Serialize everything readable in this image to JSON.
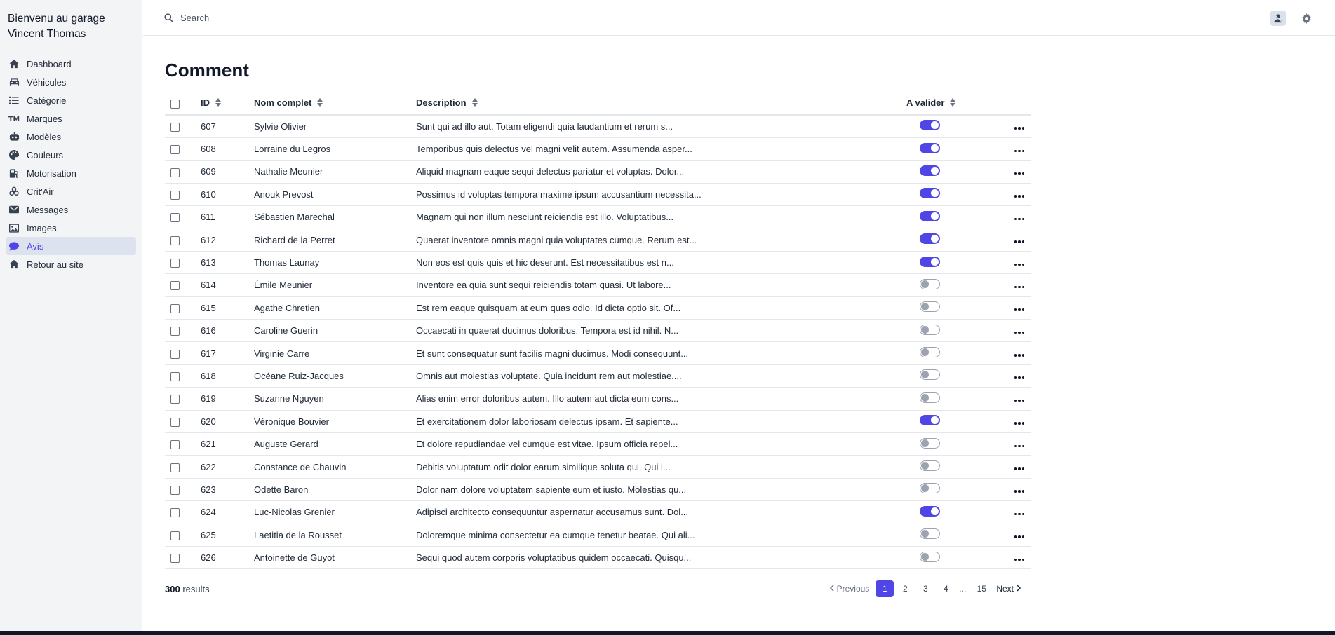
{
  "sidebar": {
    "brand_line1": "Bienvenu au garage",
    "brand_line2": "Vincent Thomas",
    "items": [
      {
        "label": "Dashboard",
        "icon": "home-icon"
      },
      {
        "label": "Véhicules",
        "icon": "car-icon"
      },
      {
        "label": "Catégorie",
        "icon": "list-icon"
      },
      {
        "label": "Marques",
        "icon": "trademark-icon"
      },
      {
        "label": "Modèles",
        "icon": "robot-icon"
      },
      {
        "label": "Couleurs",
        "icon": "palette-icon"
      },
      {
        "label": "Motorisation",
        "icon": "gas-pump-icon"
      },
      {
        "label": "Crit'Air",
        "icon": "biohazard-icon"
      },
      {
        "label": "Messages",
        "icon": "envelope-icon"
      },
      {
        "label": "Images",
        "icon": "image-icon"
      },
      {
        "label": "Avis",
        "icon": "comment-icon",
        "active": true
      },
      {
        "label": "Retour au site",
        "icon": "home-icon"
      }
    ]
  },
  "topbar": {
    "search_placeholder": "Search"
  },
  "page": {
    "title": "Comment"
  },
  "table": {
    "columns": {
      "id": "ID",
      "name": "Nom complet",
      "description": "Description",
      "validate": "A valider"
    },
    "rows": [
      {
        "id": "607",
        "name": "Sylvie Olivier",
        "description": "Sunt qui ad illo aut. Totam eligendi quia laudantium et rerum s...",
        "validated": true
      },
      {
        "id": "608",
        "name": "Lorraine du Legros",
        "description": "Temporibus quis delectus vel magni velit autem. Assumenda asper...",
        "validated": true
      },
      {
        "id": "609",
        "name": "Nathalie Meunier",
        "description": "Aliquid magnam eaque sequi delectus pariatur et voluptas. Dolor...",
        "validated": true
      },
      {
        "id": "610",
        "name": "Anouk Prevost",
        "description": "Possimus id voluptas tempora maxime ipsum accusantium necessita...",
        "validated": true
      },
      {
        "id": "611",
        "name": "Sébastien Marechal",
        "description": "Magnam qui non illum nesciunt reiciendis est illo. Voluptatibus...",
        "validated": true
      },
      {
        "id": "612",
        "name": "Richard de la Perret",
        "description": "Quaerat inventore omnis magni quia voluptates cumque. Rerum est...",
        "validated": true
      },
      {
        "id": "613",
        "name": "Thomas Launay",
        "description": "Non eos est quis quis et hic deserunt. Est necessitatibus est n...",
        "validated": true
      },
      {
        "id": "614",
        "name": "Émile Meunier",
        "description": "Inventore ea quia sunt sequi reiciendis totam quasi. Ut labore...",
        "validated": false
      },
      {
        "id": "615",
        "name": "Agathe Chretien",
        "description": "Est rem eaque quisquam at eum quas odio. Id dicta optio sit. Of...",
        "validated": false
      },
      {
        "id": "616",
        "name": "Caroline Guerin",
        "description": "Occaecati in quaerat ducimus doloribus. Tempora est id nihil. N...",
        "validated": false
      },
      {
        "id": "617",
        "name": "Virginie Carre",
        "description": "Et sunt consequatur sunt facilis magni ducimus. Modi consequunt...",
        "validated": false
      },
      {
        "id": "618",
        "name": "Océane Ruiz-Jacques",
        "description": "Omnis aut molestias voluptate. Quia incidunt rem aut molestiae....",
        "validated": false
      },
      {
        "id": "619",
        "name": "Suzanne Nguyen",
        "description": "Alias enim error doloribus autem. Illo autem aut dicta eum cons...",
        "validated": false
      },
      {
        "id": "620",
        "name": "Véronique Bouvier",
        "description": "Et exercitationem dolor laboriosam delectus ipsam. Et sapiente...",
        "validated": true
      },
      {
        "id": "621",
        "name": "Auguste Gerard",
        "description": "Et dolore repudiandae vel cumque est vitae. Ipsum officia repel...",
        "validated": false
      },
      {
        "id": "622",
        "name": "Constance de Chauvin",
        "description": "Debitis voluptatum odit dolor earum similique soluta qui. Qui i...",
        "validated": false
      },
      {
        "id": "623",
        "name": "Odette Baron",
        "description": "Dolor nam dolore voluptatem sapiente eum et iusto. Molestias qu...",
        "validated": false
      },
      {
        "id": "624",
        "name": "Luc-Nicolas Grenier",
        "description": "Adipisci architecto consequuntur aspernatur accusamus sunt. Dol...",
        "validated": true
      },
      {
        "id": "625",
        "name": "Laetitia de la Rousset",
        "description": "Doloremque minima consectetur ea cumque tenetur beatae. Qui ali...",
        "validated": false
      },
      {
        "id": "626",
        "name": "Antoinette de Guyot",
        "description": "Sequi quod autem corporis voluptatibus quidem occaecati. Quisqu...",
        "validated": false
      }
    ]
  },
  "footer": {
    "results_count": "300",
    "results_label": "results",
    "previous_label": "Previous",
    "next_label": "Next",
    "pages": [
      "1",
      "2",
      "3",
      "4"
    ],
    "ellipsis": "...",
    "last_page": "15",
    "current_page": "1"
  },
  "colors": {
    "accent": "#4f46e5",
    "sidebar_bg": "#f3f4f6",
    "active_item_bg": "#dde3ee"
  }
}
